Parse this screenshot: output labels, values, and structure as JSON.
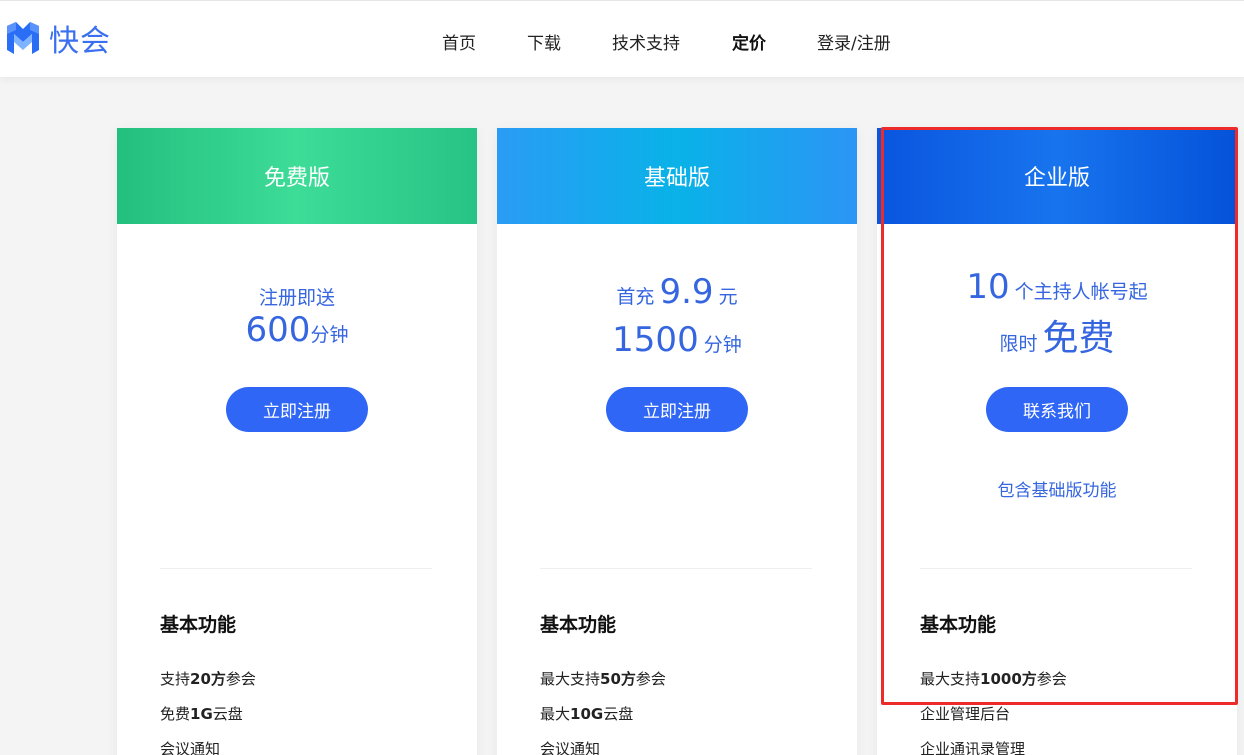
{
  "brand": {
    "logo_icon": "m-cube-logo-icon",
    "name": "快会",
    "color": "#3a6ff0"
  },
  "nav": {
    "home": "首页",
    "download": "下载",
    "support": "技术支持",
    "pricing": "定价",
    "login": "登录/注册"
  },
  "plans": [
    {
      "name": "免费版",
      "line1": "注册即送",
      "amount": "600",
      "unit": "分钟",
      "button": "立即注册",
      "features_title": "基本功能",
      "features": [
        {
          "pre": "支持",
          "bold": "20方",
          "post": "参会"
        },
        {
          "pre": "免费",
          "bold": "1G",
          "post": "云盘"
        },
        {
          "pre": "会议通知",
          "bold": "",
          "post": ""
        }
      ]
    },
    {
      "name": "基础版",
      "line1_pre": "首充",
      "line1_amount": "9.9",
      "line1_unit": "元",
      "amount": "1500",
      "unit": "分钟",
      "button": "立即注册",
      "features_title": "基本功能",
      "features": [
        {
          "pre": "最大支持",
          "bold": "50方",
          "post": "参会"
        },
        {
          "pre": "最大",
          "bold": "10G",
          "post": "云盘"
        },
        {
          "pre": "会议通知",
          "bold": "",
          "post": ""
        }
      ]
    },
    {
      "name": "企业版",
      "line1_amount": "10",
      "line1_text": "个主持人帐号起",
      "line2_pre": "限时",
      "line2_big": "免费",
      "button": "联系我们",
      "note": "包含基础版功能",
      "features_title": "基本功能",
      "features": [
        {
          "pre": "最大支持",
          "bold": "1000方",
          "post": "参会"
        },
        {
          "pre": "企业管理后台",
          "bold": "",
          "post": ""
        },
        {
          "pre": "企业通讯录管理",
          "bold": "",
          "post": ""
        }
      ]
    }
  ],
  "colors": {
    "accent": "#2f66f6",
    "price_text": "#3566e0",
    "free_header": "#2fcf8c",
    "basic_header": "#13a9ee",
    "enterprise_header": "#0e63e6",
    "highlight_border": "#ee2b2b"
  }
}
